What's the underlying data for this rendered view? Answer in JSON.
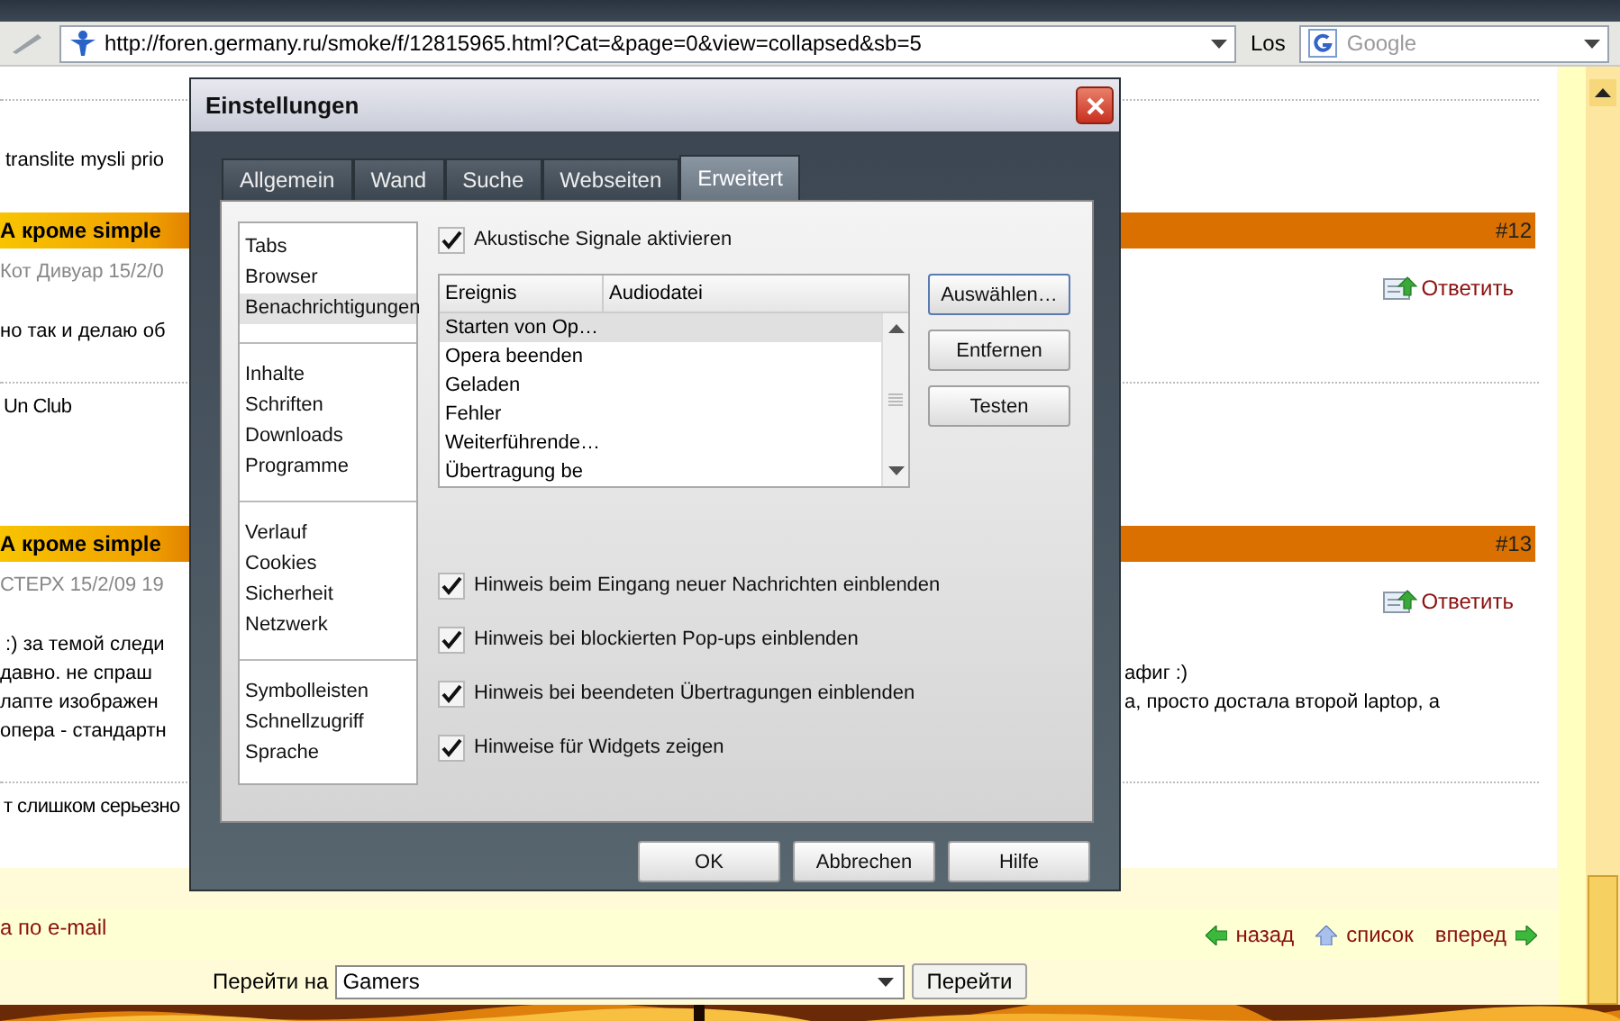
{
  "browser": {
    "address": "http://foren.germany.ru/smoke/f/12815965.html?Cat=&page=0&view=collapsed&sb=5",
    "go_button": "Los",
    "search_placeholder": "Google"
  },
  "forum": {
    "intro": "translite mysli prio",
    "posts": [
      {
        "title": "А кроме simple",
        "number": "#12",
        "author": "Кот Дивуар 15/2/0",
        "reply": "Ответить",
        "lines": [
          {
            "left": "но так и делаю об"
          }
        ],
        "signature": "Un Club"
      },
      {
        "title": "А кроме simple",
        "number": "#13",
        "author": "СТЕРХ 15/2/09 19",
        "reply": "Ответить",
        "lines": [
          {
            "left": " :) за темой следи"
          },
          {
            "left": "давно. не спраш",
            "right": "афиг :)"
          },
          {
            "left": "лапте изображен",
            "right": "а, просто достала второй laptop, а"
          },
          {
            "left": "опера - стандартн"
          }
        ],
        "signature": "т слишком серьезно"
      }
    ]
  },
  "footer": {
    "email_link": "а по e-mail",
    "nav": [
      {
        "label": "назад",
        "kind": "back"
      },
      {
        "label": "список",
        "kind": "up"
      },
      {
        "label": "вперед",
        "kind": "forward"
      }
    ],
    "goto_label": "Перейти на",
    "goto_value": "Gamers",
    "goto_button": "Перейти"
  },
  "dialog": {
    "title": "Einstellungen",
    "tabs": [
      {
        "label": "Allgemein",
        "selected": false
      },
      {
        "label": "Wand",
        "selected": false
      },
      {
        "label": "Suche",
        "selected": false
      },
      {
        "label": "Webseiten",
        "selected": false
      },
      {
        "label": "Erweitert",
        "selected": true
      }
    ],
    "sections": [
      [
        {
          "label": "Tabs",
          "selected": false
        },
        {
          "label": "Browser",
          "selected": false
        },
        {
          "label": "Benachrichtigungen",
          "selected": true
        }
      ],
      [
        {
          "label": "Inhalte",
          "selected": false
        },
        {
          "label": "Schriften",
          "selected": false
        },
        {
          "label": "Downloads",
          "selected": false
        },
        {
          "label": "Programme",
          "selected": false
        }
      ],
      [
        {
          "label": "Verlauf",
          "selected": false
        },
        {
          "label": "Cookies",
          "selected": false
        },
        {
          "label": "Sicherheit",
          "selected": false
        },
        {
          "label": "Netzwerk",
          "selected": false
        }
      ],
      [
        {
          "label": "Symbolleisten",
          "selected": false
        },
        {
          "label": "Schnellzugriff",
          "selected": false
        },
        {
          "label": "Sprache",
          "selected": false
        }
      ]
    ],
    "sound": {
      "label": "Akustische Signale aktivieren",
      "checked": true
    },
    "table": {
      "columns": [
        "Ereignis",
        "Audiodatei"
      ],
      "rows": [
        {
          "event": "Starten von Op…",
          "selected": true
        },
        {
          "event": "Opera beenden",
          "selected": false
        },
        {
          "event": "Geladen",
          "selected": false
        },
        {
          "event": "Fehler",
          "selected": false
        },
        {
          "event": "Weiterführende…",
          "selected": false
        },
        {
          "event": "Übertragung be",
          "selected": false
        }
      ]
    },
    "side_buttons": [
      "Auswählen…",
      "Entfernen",
      "Testen"
    ],
    "options": [
      {
        "label": "Hinweis beim Eingang neuer Nachrichten einblenden",
        "checked": true
      },
      {
        "label": "Hinweis bei blockierten Pop-ups einblenden",
        "checked": true
      },
      {
        "label": "Hinweis bei beendeten Übertragungen einblenden",
        "checked": true
      },
      {
        "label": "Hinweise für Widgets zeigen",
        "checked": true
      }
    ],
    "buttons": [
      "OK",
      "Abbrechen",
      "Hilfe"
    ]
  }
}
